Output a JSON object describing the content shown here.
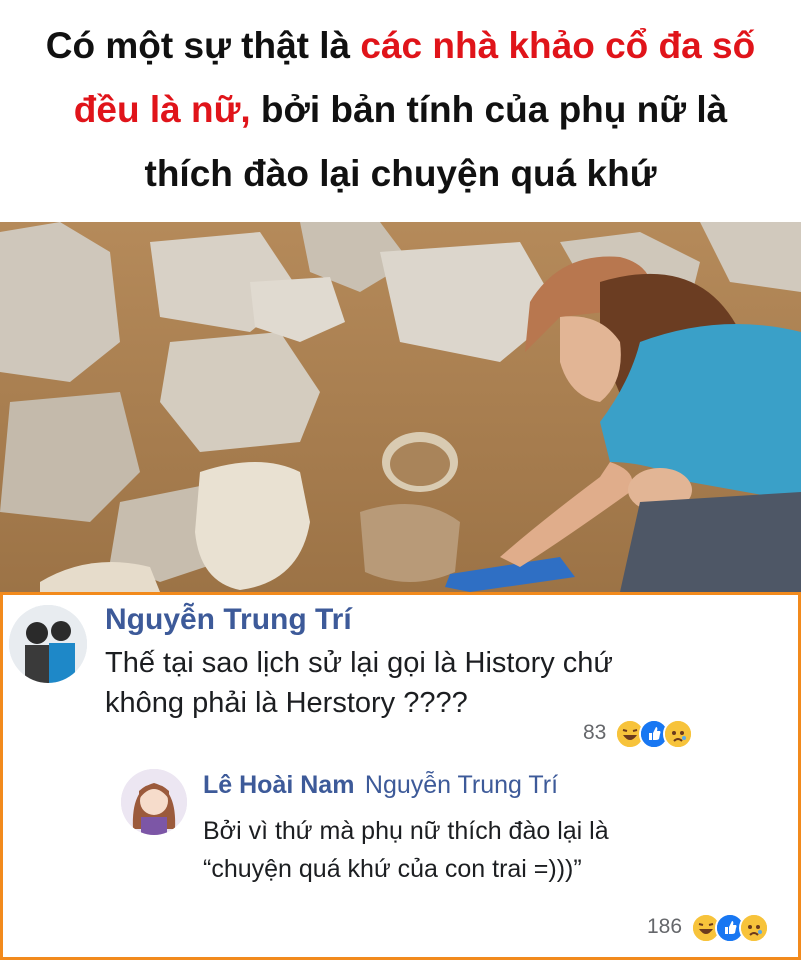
{
  "headline": {
    "line1_black": "Có một sự thật là ",
    "line1_red": "các nhà khảo cổ đa số",
    "line2_red": "đều là nữ,",
    "line2_black": " bởi bản tính của phụ nữ là",
    "line3": "thích đào lại chuyện quá khứ"
  },
  "comment": {
    "author": "Nguyễn Trung Trí",
    "text_line1": "Thế tại sao lịch sử lại gọi là History chứ",
    "text_line2": "không phải là Herstory ????",
    "reaction_count": "83"
  },
  "reply": {
    "author": "Lê Hoài Nam",
    "mention": "Nguyễn Trung Trí",
    "text_line1": "Bởi vì thứ mà phụ nữ thích đào lại là",
    "text_line2": "“chuyện quá khứ của con trai =)))”",
    "reaction_count": "186"
  },
  "colors": {
    "headline_red": "#e0141a",
    "card_border": "#f28a1c",
    "name_blue": "#3d5a99"
  },
  "icons": [
    "haha-reaction-icon",
    "like-reaction-icon",
    "sad-reaction-icon"
  ]
}
